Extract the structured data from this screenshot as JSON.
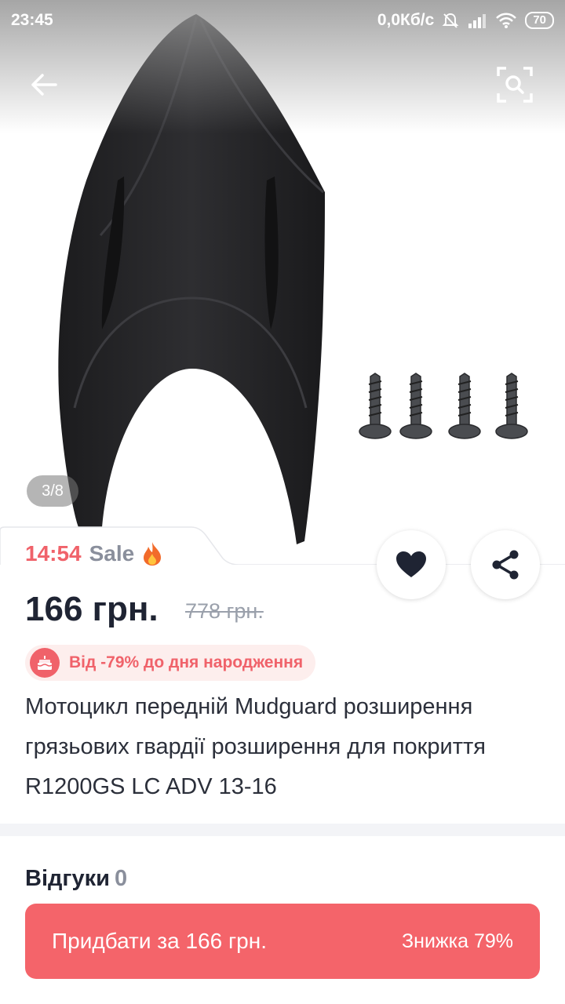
{
  "status_bar": {
    "time": "23:45",
    "network_speed": "0,0Кб/с",
    "battery": "70"
  },
  "image_viewer": {
    "counter": "3/8"
  },
  "sale": {
    "timer": "14:54",
    "label": "Sale"
  },
  "product": {
    "price": "166 грн.",
    "old_price": "778 грн.",
    "promo": "Від -79% до дня народження",
    "title": "Мотоцикл передній Mudguard розширення грязьових гвардії розширення для покриття R1200GS LC ADV 13-16"
  },
  "reviews": {
    "label": "Відгуки",
    "count": "0"
  },
  "buy_button": {
    "label": "Придбати за 166 грн.",
    "discount": "Знижка 79%"
  },
  "colors": {
    "accent": "#f4646a",
    "sale_timer": "#f0626a",
    "text_dark": "#1f2433",
    "muted": "#8a8f9c"
  },
  "icons": [
    "back-arrow-icon",
    "image-search-icon",
    "heart-icon",
    "share-icon",
    "fire-icon",
    "birthday-cake-icon",
    "mute-icon",
    "signal-icon",
    "wifi-icon"
  ]
}
